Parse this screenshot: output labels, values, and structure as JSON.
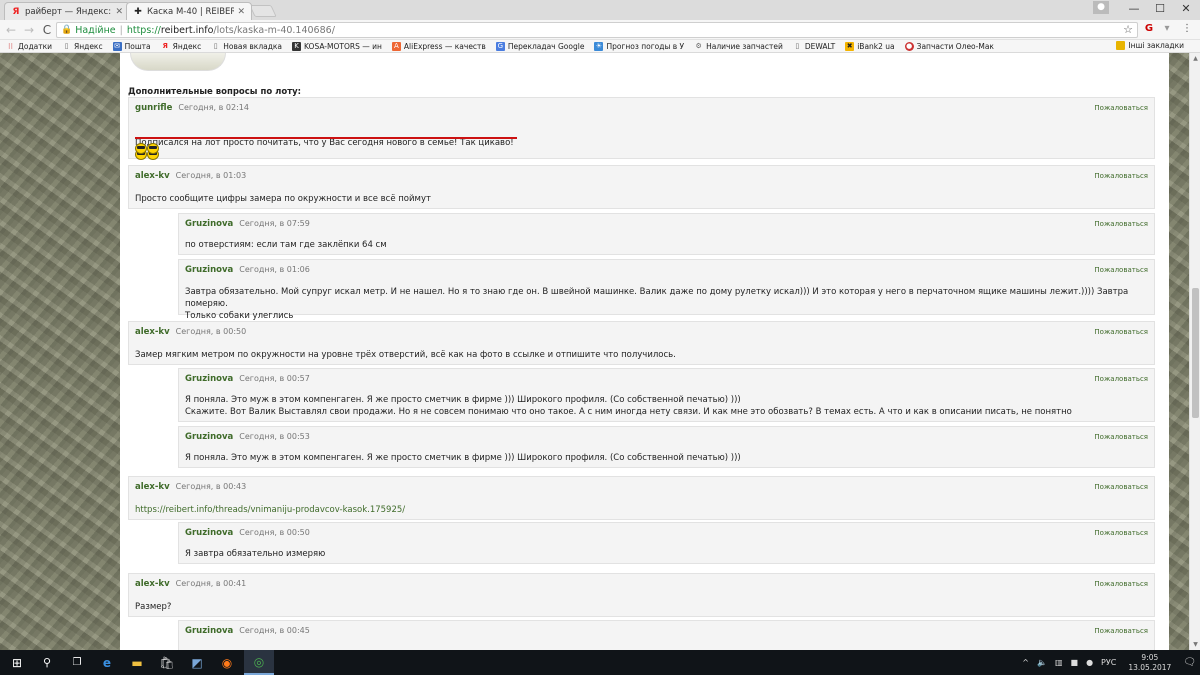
{
  "tabs": [
    {
      "title": "райберт — Яндекс: наш",
      "icon": "Я",
      "active": false
    },
    {
      "title": "Каска М-40 | REIBERT.inf",
      "icon": "✚",
      "active": true
    }
  ],
  "window_controls": {
    "minimize": "—",
    "maximize": "☐",
    "close": "✕"
  },
  "toolbar": {
    "back": "←",
    "forward": "→",
    "reload": "C",
    "secure_label": "Надійне",
    "url_scheme": "https://",
    "url_host": "reibert.info",
    "url_path": "/lots/kaska-m-40.140686/"
  },
  "bookmarks": [
    {
      "label": "Додатки",
      "icon": "apps-icon",
      "color": "#e44"
    },
    {
      "label": "Яндекс",
      "icon": "doc-icon",
      "color": "#888"
    },
    {
      "label": "Пошта",
      "icon": "mail-icon",
      "color": "#3b6fc4"
    },
    {
      "label": "Яндекс",
      "icon": "yandex-icon",
      "color": "#e22"
    },
    {
      "label": "Новая вкладка",
      "icon": "doc-icon",
      "color": "#888"
    },
    {
      "label": "KOSA-MOTORS — ин",
      "icon": "kosa-icon",
      "color": "#333"
    },
    {
      "label": "AliExpress — качеств",
      "icon": "aliexpress-icon",
      "color": "#e63"
    },
    {
      "label": "Перекладач Google",
      "icon": "translate-icon",
      "color": "#4a7de0"
    },
    {
      "label": "Прогноз погоды в У",
      "icon": "weather-icon",
      "color": "#3a8ad8"
    },
    {
      "label": "Наличие запчастей",
      "icon": "parts-icon",
      "color": "#666"
    },
    {
      "label": "DEWALT",
      "icon": "doc-icon",
      "color": "#888"
    },
    {
      "label": "iBank2 ua",
      "icon": "ibank-icon",
      "color": "#f5b400"
    },
    {
      "label": "Запчасти Олео-Мак",
      "icon": "oleomac-icon",
      "color": "#c33"
    }
  ],
  "other_bookmarks": "Інші закладки",
  "section_title": "Дополнительные вопросы по лоту:",
  "report_label": "Пожаловаться",
  "comments": [
    {
      "author": "gunrifle",
      "time": "Сегодня, в 02:14",
      "text": "Подписался на лот просто почитать, что у Вас сегодня нового в семье! Так цикаво!"
    },
    {
      "author": "alex-kv",
      "time": "Сегодня, в 01:03",
      "text": "Просто сообщите цифры замера по окружности и все всё поймут"
    },
    {
      "author": "Gruzinova",
      "time": "Сегодня, в 07:59",
      "text": "по отверстиям: если там где заклёпки 64 см"
    },
    {
      "author": "Gruzinova",
      "time": "Сегодня, в 01:06",
      "text": "Завтра обязательно. Мой супруг искал метр. И не нашел. Но я то знаю где он. В швейной машинке. Валик даже по дому рулетку искал))) И это которая у него в перчаточном ящике машины лежит.)))) Завтра померяю.\nТолько собаки улеглись"
    },
    {
      "author": "alex-kv",
      "time": "Сегодня, в 00:50",
      "text": "Замер мягким метром по окружности на уровне трёх отверстий, всё как на фото в ссылке и отпишите что получилось."
    },
    {
      "author": "Gruzinova",
      "time": "Сегодня, в 00:57",
      "text": "Я поняла. Это муж в этом компенгаген. Я же просто сметчик в фирме ))) Широкого профиля. (Со собственной печатью) )))\nСкажите. Вот Валик Выставлял свои продажи. Но я не совсем понимаю что оно такое. А с ним иногда нету связи. И как мне это обозвать? В темах есть. А что и как в описании писать, не понятно"
    },
    {
      "author": "Gruzinova",
      "time": "Сегодня, в 00:53",
      "text": "Я поняла. Это муж в этом компенгаген. Я же просто сметчик в фирме ))) Широкого профиля. (Со собственной печатью) )))"
    },
    {
      "author": "alex-kv",
      "time": "Сегодня, в 00:43",
      "text": "https://reibert.info/threads/vnimaniju-prodavcov-kasok.175925/"
    },
    {
      "author": "Gruzinova",
      "time": "Сегодня, в 00:50",
      "text": "Я завтра обязательно измеряю"
    },
    {
      "author": "alex-kv",
      "time": "Сегодня, в 00:41",
      "text": "Размер?"
    },
    {
      "author": "Gruzinova",
      "time": "Сегодня, в 00:45",
      "text": ""
    }
  ],
  "taskbar": {
    "lang": "РУС",
    "time": "9:05",
    "date": "13.05.2017"
  },
  "colors": {
    "author": "#3f6b2a",
    "underline": "#cc1111",
    "taskbar": "#101418"
  }
}
